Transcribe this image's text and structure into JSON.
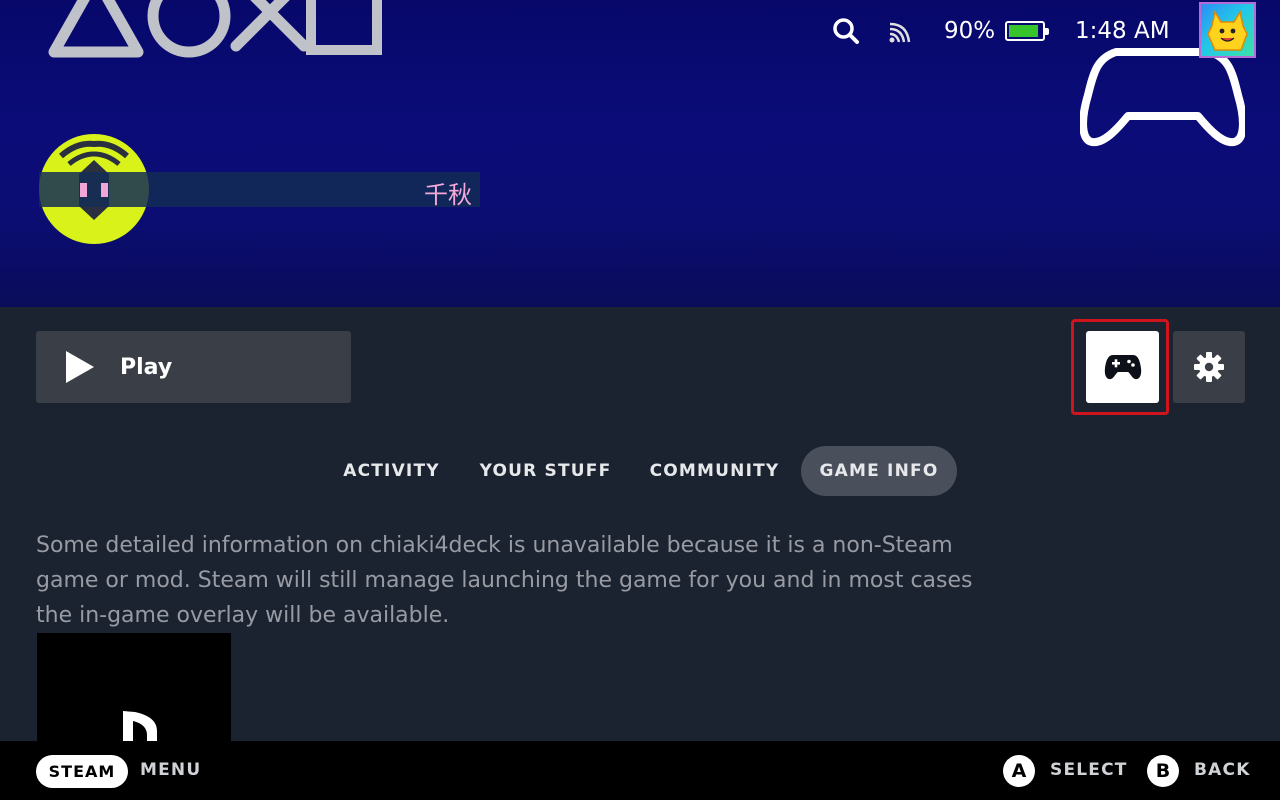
{
  "status_bar": {
    "battery_percent": "90%",
    "battery_level": 0.9,
    "time": "1:48 AM"
  },
  "hero": {
    "logo_text": "千秋"
  },
  "actions": {
    "play_label": "Play"
  },
  "tabs": [
    {
      "label": "ACTIVITY",
      "active": false
    },
    {
      "label": "YOUR STUFF",
      "active": false
    },
    {
      "label": "COMMUNITY",
      "active": false
    },
    {
      "label": "GAME INFO",
      "active": true
    }
  ],
  "game_info": {
    "text": "Some detailed information on chiaki4deck is unavailable because it is a non-Steam game or mod. Steam will still manage launching the game for you and in most cases the in-game overlay will be available."
  },
  "footer": {
    "steam_label": "STEAM",
    "menu_label": "MENU",
    "a_glyph": "A",
    "select_label": "SELECT",
    "b_glyph": "B",
    "back_label": "BACK"
  },
  "colors": {
    "accent_highlight": "#d0141e",
    "battery_green": "#37c42d"
  },
  "icons": [
    "search-icon",
    "wifi-icon",
    "battery-icon",
    "avatar",
    "play-icon",
    "controller-icon",
    "gear-icon"
  ]
}
